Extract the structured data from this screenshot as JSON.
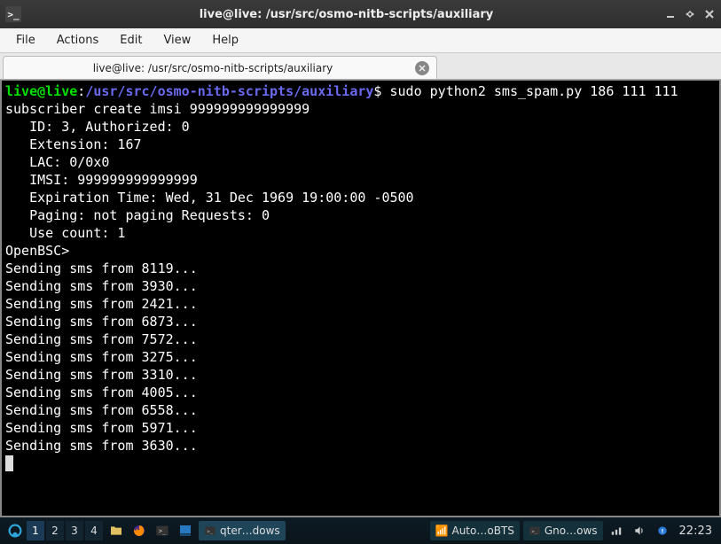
{
  "window": {
    "app_icon": ">_",
    "title": "live@live: /usr/src/osmo-nitb-scripts/auxiliary"
  },
  "menu": {
    "file": "File",
    "actions": "Actions",
    "edit": "Edit",
    "view": "View",
    "help": "Help"
  },
  "tab": {
    "label": "live@live: /usr/src/osmo-nitb-scripts/auxiliary"
  },
  "prompt": {
    "user": "live@live",
    "sep": ":",
    "path": "/usr/src/osmo-nitb-scripts/auxiliary",
    "dollar": "$",
    "command": "sudo python2 sms_spam.py 186 111 111"
  },
  "output": {
    "sub_create": "subscriber create imsi 999999999999999",
    "id_line": "   ID: 3, Authorized: 0",
    "ext_line": "   Extension: 167",
    "lac_line": "   LAC: 0/0x0",
    "imsi_line": "   IMSI: 999999999999999",
    "exp_line": "   Expiration Time: Wed, 31 Dec 1969 19:00:00 -0500",
    "paging_line": "   Paging: not paging Requests: 0",
    "usecount_line": "   Use count: 1",
    "openbsc": "OpenBSC>",
    "sending": [
      "Sending sms from 8119...",
      "Sending sms from 3930...",
      "Sending sms from 2421...",
      "Sending sms from 6873...",
      "Sending sms from 7572...",
      "Sending sms from 3275...",
      "Sending sms from 3310...",
      "Sending sms from 4005...",
      "Sending sms from 6558...",
      "Sending sms from 5971...",
      "Sending sms from 3630..."
    ]
  },
  "taskbar": {
    "workspaces": [
      "1",
      "2",
      "3",
      "4"
    ],
    "active_workspace": 0,
    "tasks": [
      {
        "icon": ">_",
        "label": "qter…dows",
        "active": true
      },
      {
        "icon": "📶",
        "label": "Auto…oBTS",
        "active": false
      },
      {
        "icon": ">_",
        "label": "Gno…ows",
        "active": false
      }
    ],
    "clock": "22:23"
  }
}
